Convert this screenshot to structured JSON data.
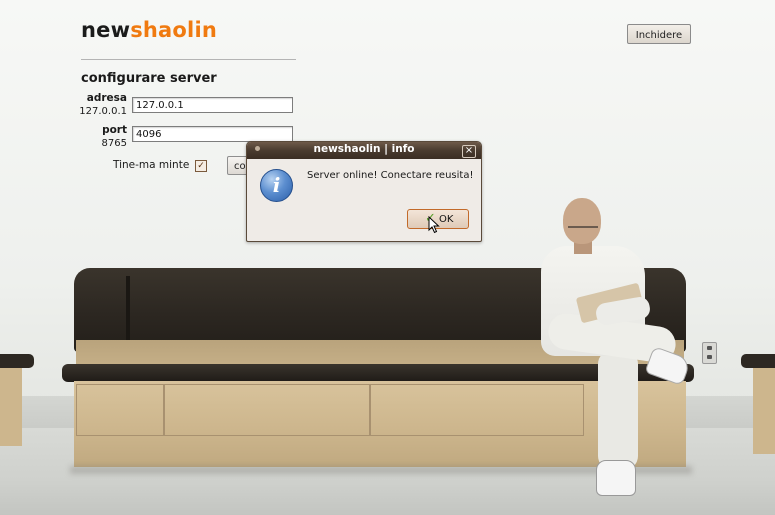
{
  "app": {
    "logo_part1": "new",
    "logo_part2": "shaolin",
    "close_label": "Inchidere"
  },
  "server_config": {
    "title": "configurare server",
    "address_label": "adresa",
    "address_default": "127.0.0.1",
    "address_value": "127.0.0.1",
    "port_label": "port",
    "port_default": "8765",
    "port_value": "4096",
    "remember_label": "Tine-ma minte",
    "remember_checked": true,
    "connect_label_visible": "co"
  },
  "dialog": {
    "title": "newshaolin | info",
    "message": "Server online! Conectare reusita!",
    "ok_label": "OK",
    "icon": "info-icon"
  },
  "colors": {
    "brand_orange": "#f07a10",
    "titlebar": "#4a3b2f"
  }
}
